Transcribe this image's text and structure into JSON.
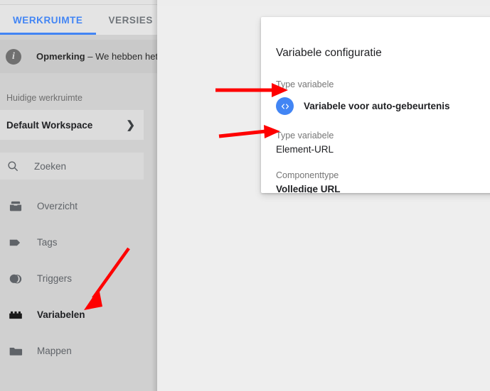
{
  "app": {
    "tabs": [
      {
        "label": "WERKRUIMTE",
        "active": true
      },
      {
        "label": "VERSIES",
        "active": false
      }
    ],
    "accent_color": "#4285f4",
    "panel_bg": "#d0d0d0",
    "content_bg": "#eeeeee"
  },
  "notice": {
    "icon": "info-icon",
    "icon_glyph": "i",
    "title": "Opmerking",
    "separator": "–",
    "body": "We hebben het"
  },
  "workspace": {
    "section_label": "Huidige werkruimte",
    "name": "Default Workspace",
    "chevron": "❯"
  },
  "search": {
    "placeholder": "Zoeken",
    "icon": "search-icon"
  },
  "nav": {
    "items": [
      {
        "label": "Overzicht",
        "icon": "overview-icon",
        "active": false
      },
      {
        "label": "Tags",
        "icon": "tag-icon",
        "active": false
      },
      {
        "label": "Triggers",
        "icon": "trigger-icon",
        "active": false
      },
      {
        "label": "Variabelen",
        "icon": "variable-icon",
        "active": true
      },
      {
        "label": "Mappen",
        "icon": "folder-icon",
        "active": false
      }
    ]
  },
  "dialog": {
    "title": "Variabele configuratie",
    "fields": {
      "type_label_1": "Type variabele",
      "type_value_1": "Variabele voor auto-gebeurtenis",
      "type_badge_icon": "code-brackets-icon",
      "type_badge_color": "#4285f4",
      "type_label_2": "Type variabele",
      "type_value_2": "Element-URL",
      "component_label": "Componenttype",
      "component_value": "Volledige URL"
    }
  },
  "annotations": {
    "color": "#fe0000",
    "arrows": [
      {
        "name": "arrow-to-variable-type-badge",
        "points_to": "Variabele voor auto-gebeurtenis"
      },
      {
        "name": "arrow-to-element-url",
        "points_to": "Element-URL"
      },
      {
        "name": "arrow-to-sidebar-variabelen",
        "points_to": "Variabelen"
      }
    ]
  }
}
